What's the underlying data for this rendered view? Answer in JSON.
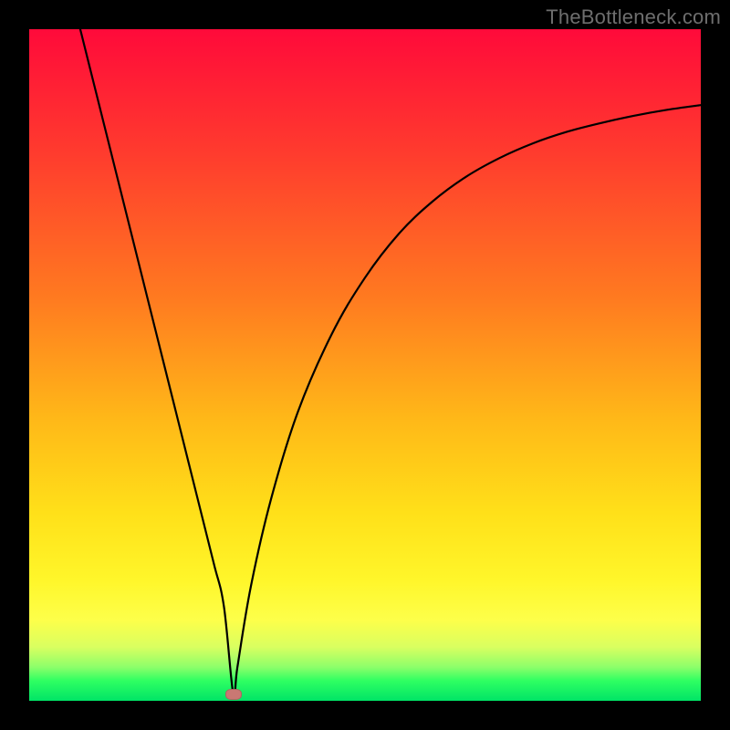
{
  "watermark": "TheBottleneck.com",
  "chart_data": {
    "type": "line",
    "title": "",
    "xlabel": "",
    "ylabel": "",
    "xlim": [
      0,
      100
    ],
    "ylim": [
      0,
      100
    ],
    "series": [
      {
        "name": "curve",
        "x": [
          7.6,
          10,
          12.5,
          15,
          17.5,
          20,
          22.5,
          25,
          27.5,
          29,
          30.4,
          31,
          33,
          36,
          40,
          45,
          50,
          55,
          60,
          65,
          70,
          75,
          80,
          85,
          90,
          95,
          100
        ],
        "values": [
          100,
          90.4,
          80.4,
          70.4,
          60.4,
          50.4,
          40.4,
          30.4,
          20.4,
          14,
          0.9,
          5,
          17,
          30,
          43,
          54.5,
          63,
          69.5,
          74.3,
          78,
          80.8,
          83,
          84.7,
          86,
          87.1,
          88,
          88.7
        ]
      }
    ],
    "marker": {
      "x": 30.4,
      "y": 0.9
    },
    "background": {
      "type": "vertical_gradient",
      "stops": [
        {
          "pos": 0,
          "color": "#ff0a3a"
        },
        {
          "pos": 40,
          "color": "#ff7a20"
        },
        {
          "pos": 72,
          "color": "#ffe019"
        },
        {
          "pos": 88,
          "color": "#fdff4a"
        },
        {
          "pos": 100,
          "color": "#00e466"
        }
      ]
    },
    "frame_color": "#000000"
  }
}
